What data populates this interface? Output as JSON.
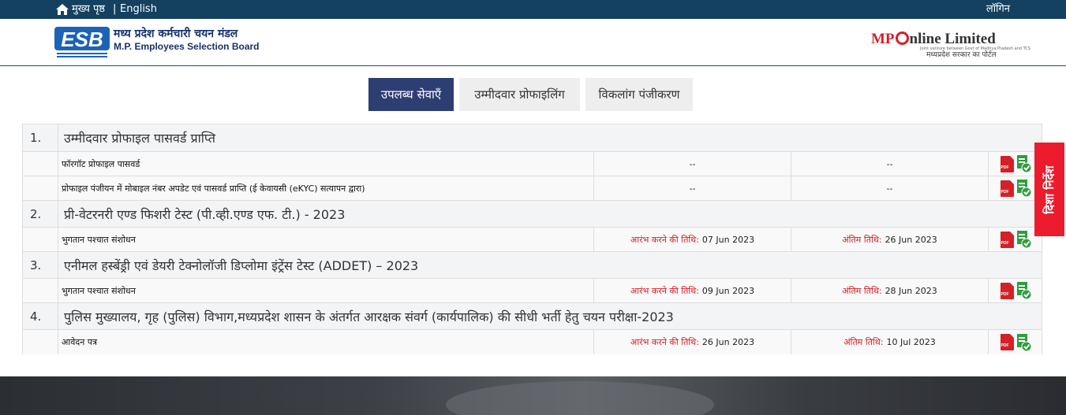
{
  "topbar": {
    "home_label": "मुख्य पृष्ठ",
    "separator": "|",
    "english": "English",
    "login": "लॉगिन"
  },
  "header": {
    "esb_logo_text": "ESB",
    "org_name_hi": "मध्य प्रदेश कर्मचारी चयन मंडल",
    "org_name_en": "M.P. Employees Selection Board",
    "mponline_mp": "MP",
    "mponline_rest": "nline Limited",
    "mponline_small": "Joint venture between Govt of Madhya Pradesh and TCS",
    "mponline_tagline": "मध्यप्रदेश सरकार का पोर्टल"
  },
  "tabs": [
    {
      "label": "उपलब्ध सेवाएँ",
      "active": true
    },
    {
      "label": "उम्मीदवार प्रोफाइलिंग",
      "active": false
    },
    {
      "label": "विकलांग पंजीकरण",
      "active": false
    }
  ],
  "table": {
    "sections": [
      {
        "num": "1.",
        "title": "उम्मीदवार प्रोफाइल पासवर्ड प्राप्ति",
        "items": [
          {
            "name": "फॉरगॉट प्रोफाइल पासवर्ड",
            "start_label": "",
            "start": "--",
            "end_label": "",
            "end": "--"
          },
          {
            "name": "प्रोफाइल पंजीयन में मोबाइल नंबर अपडेट एवं पासवर्ड प्राप्ति (ई केवायसी (eKYC) सत्यापन द्वारा)",
            "start_label": "",
            "start": "--",
            "end_label": "",
            "end": "--"
          }
        ]
      },
      {
        "num": "2.",
        "title": "प्री-वेटरनरी एण्ड फिशरी टेस्ट (पी.व्ही.एण्ड एफ. टी.) - 2023",
        "items": [
          {
            "name": "भुगतान पश्चात संशोधन",
            "start_label": "आरंभ करने की तिथि:",
            "start": "07 Jun 2023",
            "end_label": "अंतिम तिथि:",
            "end": "26 Jun 2023"
          }
        ]
      },
      {
        "num": "3.",
        "title": "एनीमल हस्बेंड्री एवं डेयरी टेक्नोलॉजी डिप्लोमा इंट्रेंस टेस्ट (ADDET) – 2023",
        "items": [
          {
            "name": "भुगतान पश्चात संशोधन",
            "start_label": "आरंभ करने की तिथि:",
            "start": "09 Jun 2023",
            "end_label": "अंतिम तिथि:",
            "end": "28 Jun 2023"
          }
        ]
      },
      {
        "num": "4.",
        "title": "पुलिस मुख्यालय, गृह (पुलिस) विभाग,मध्यप्रदेश शासन के अंतर्गत आरक्षक संवर्ग (कार्यपालिक) की सीधी भर्ती हेतु चयन परीक्षा-2023",
        "items": [
          {
            "name": "आवेदन पत्र",
            "start_label": "आरंभ करने की तिथि:",
            "start": "26 Jun 2023",
            "end_label": "अंतिम तिथि:",
            "end": "10 Jul 2023"
          }
        ]
      }
    ]
  },
  "side_button": "दिशा निर्देश",
  "colors": {
    "topbar_bg": "#13415f",
    "tab_active_bg": "#2d3e73",
    "date_label": "#d42027",
    "side_button_bg": "#ec1b2e",
    "check_icon": "#2e9e3e"
  },
  "icons": [
    "home-icon",
    "pdf-icon",
    "checklist-icon"
  ]
}
